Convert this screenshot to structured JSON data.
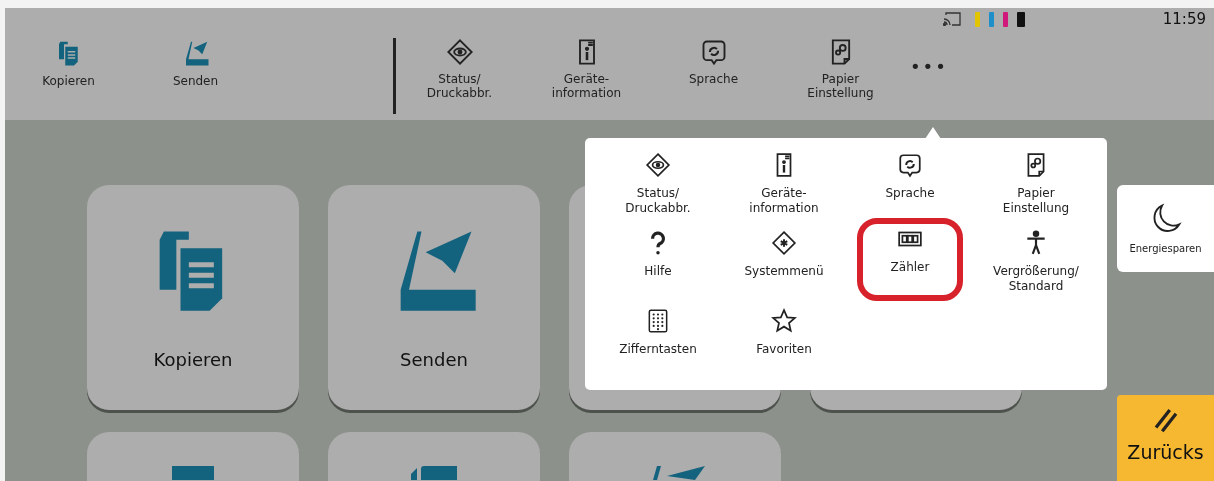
{
  "status_bar": {
    "toner": [
      {
        "color": "#e2c400"
      },
      {
        "color": "#1e8fc8"
      },
      {
        "color": "#d0197a"
      },
      {
        "color": "#111111"
      }
    ],
    "time": "11:59"
  },
  "toolbar": {
    "favorites": [
      {
        "label": "Kopieren",
        "kind": "copy"
      },
      {
        "label": "Senden",
        "kind": "send"
      }
    ],
    "shortcuts": [
      {
        "label": "Status/\nDruckabbr.",
        "kind": "status"
      },
      {
        "label": "Geräte-\ninformation",
        "kind": "info"
      },
      {
        "label": "Sprache",
        "kind": "language"
      },
      {
        "label": "Papier\nEinstellung",
        "kind": "paper"
      }
    ],
    "more": "•••"
  },
  "tiles": [
    {
      "label": "Kopieren",
      "kind": "copy"
    },
    {
      "label": "Senden",
      "kind": "send"
    },
    {
      "kind": "blank"
    },
    {
      "kind": "blank"
    },
    {
      "kind": "bar_top"
    },
    {
      "kind": "copy_top"
    },
    {
      "kind": "send_top"
    }
  ],
  "popup_menu": {
    "items": [
      {
        "label": "Status/\nDruckabbr.",
        "kind": "status",
        "highlighted": false
      },
      {
        "label": "Geräte-\ninformation",
        "kind": "info",
        "highlighted": false
      },
      {
        "label": "Sprache",
        "kind": "language",
        "highlighted": false
      },
      {
        "label": "Papier\nEinstellung",
        "kind": "paper",
        "highlighted": false
      },
      {
        "label": "Hilfe",
        "kind": "help",
        "highlighted": false
      },
      {
        "label": "Systemmenü",
        "kind": "system",
        "highlighted": false
      },
      {
        "label": "Zähler",
        "kind": "counter",
        "highlighted": true
      },
      {
        "label": "Vergrößerung/\nStandard",
        "kind": "accessibility",
        "highlighted": false
      },
      {
        "label": "Zifferntasten",
        "kind": "keypad",
        "highlighted": false
      },
      {
        "label": "Favoriten",
        "kind": "star",
        "highlighted": false
      }
    ]
  },
  "energy_button": {
    "label": "Energiesparen"
  },
  "back_button": {
    "label": "Zurücks"
  }
}
